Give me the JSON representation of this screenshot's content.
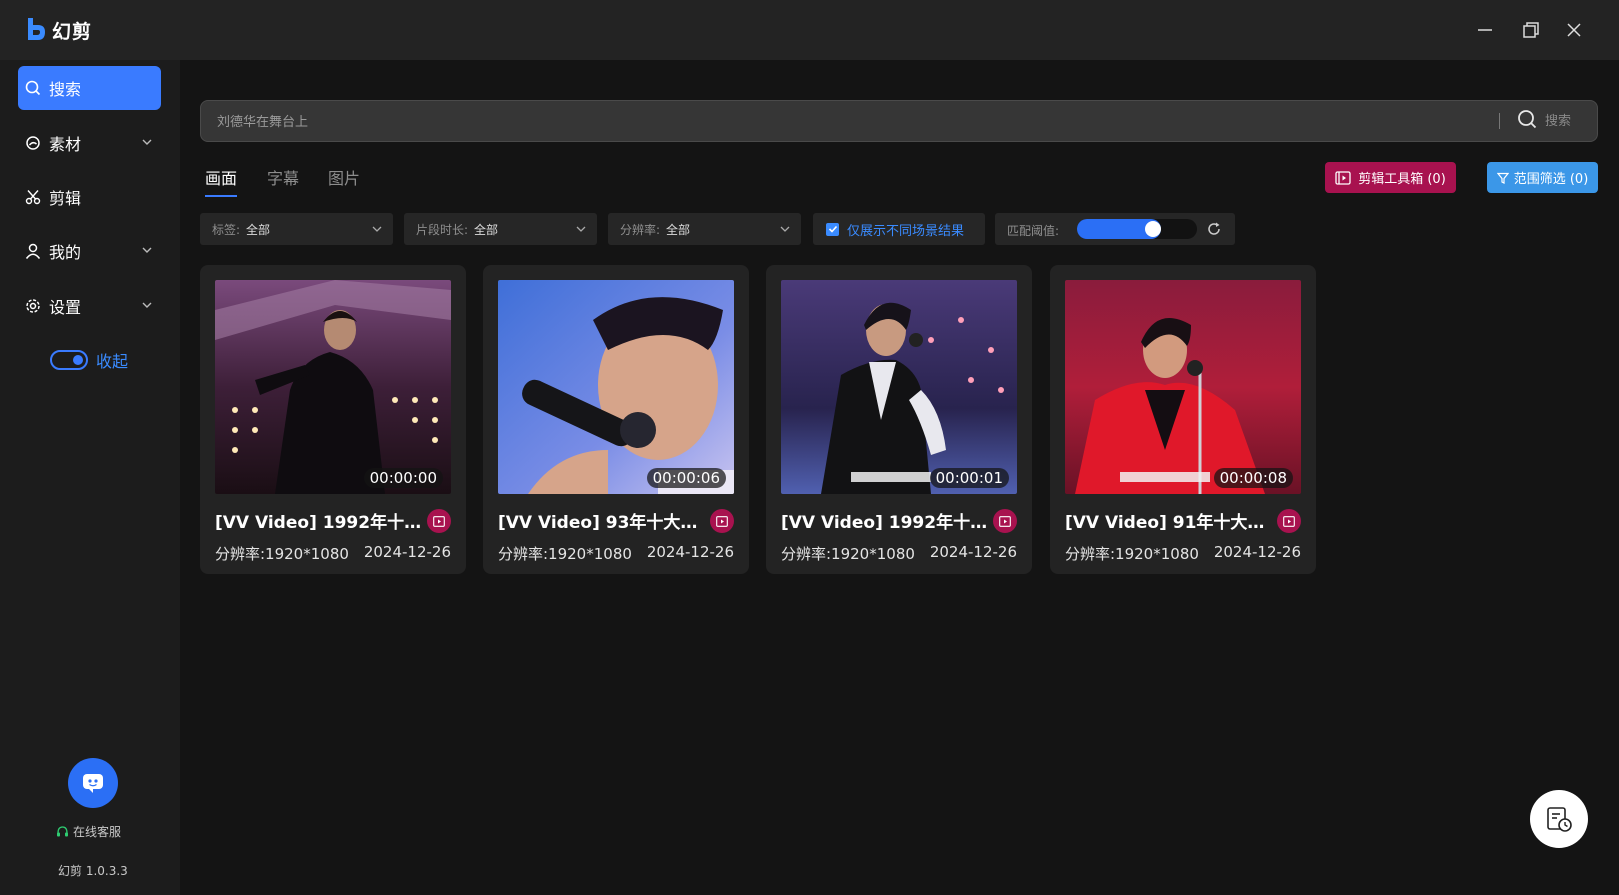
{
  "app": {
    "name": "幻剪",
    "version": "幻剪 1.0.3.3"
  },
  "window_controls": [
    {
      "name": "minimize-icon"
    },
    {
      "name": "restore-icon"
    },
    {
      "name": "close-icon"
    }
  ],
  "sidebar": {
    "items": [
      {
        "label": "搜索",
        "icon": "search-icon",
        "active": true,
        "expandable": false
      },
      {
        "label": "素材",
        "icon": "material-icon",
        "active": false,
        "expandable": true
      },
      {
        "label": "剪辑",
        "icon": "scissors-icon",
        "active": false,
        "expandable": false
      },
      {
        "label": "我的",
        "icon": "user-icon",
        "active": false,
        "expandable": true
      },
      {
        "label": "设置",
        "icon": "gear-icon",
        "active": false,
        "expandable": true
      }
    ],
    "collapse_label": "收起",
    "support_label": "在线客服"
  },
  "search": {
    "placeholder": "刘德华在舞台上",
    "button_label": "搜索"
  },
  "tabs": [
    {
      "label": "画面",
      "active": true
    },
    {
      "label": "字幕",
      "active": false
    },
    {
      "label": "图片",
      "active": false
    }
  ],
  "actions": {
    "toolbox_label": "剪辑工具箱 (0)",
    "filter_label": "范围筛选 (0)"
  },
  "filters": {
    "tag": {
      "label": "标签:",
      "value": "全部"
    },
    "duration": {
      "label": "片段时长:",
      "value": "全部"
    },
    "resolution": {
      "label": "分辨率:",
      "value": "全部"
    },
    "unique_scene": {
      "label": "仅展示不同场景结果",
      "checked": true
    },
    "threshold": {
      "label": "匹配阈值:",
      "level": 0.66
    }
  },
  "results": [
    {
      "title": "[VV Video] 1992年十大...",
      "duration": "00:00:00",
      "resolution": "分辨率:1920*1080",
      "date": "2024-12-26"
    },
    {
      "title": "[VV Video] 93年十大劲...",
      "duration": "00:00:06",
      "resolution": "分辨率:1920*1080",
      "date": "2024-12-26"
    },
    {
      "title": "[VV Video] 1992年十大...",
      "duration": "00:00:01",
      "resolution": "分辨率:1920*1080",
      "date": "2024-12-26"
    },
    {
      "title": "[VV Video] 91年十大劲...",
      "duration": "00:00:08",
      "resolution": "分辨率:1920*1080",
      "date": "2024-12-26"
    }
  ],
  "colors": {
    "accent": "#3a7bff",
    "magenta": "#a8124f",
    "filter_blue": "#3b97e8"
  }
}
